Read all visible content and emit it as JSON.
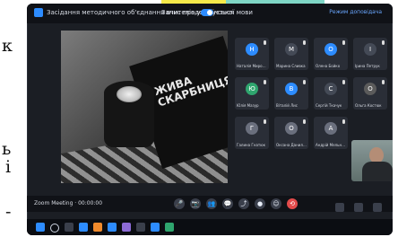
{
  "left_text_fragments": [
    "к",
    "ь",
    "і",
    "-"
  ],
  "zoom": {
    "title": "Засідання методичного об'єднання вчителів української мови",
    "recording_label": "Запис продовжується",
    "top_right_label": "Режим доповідача",
    "shared_book_title": "ЖИВА СКАРБНИЦЯ",
    "meeting_meta": "Zoom Meeting · 00:00:00",
    "participants": [
      {
        "name": "Наталія Миронюк",
        "initial": "Н",
        "color": "#2d8cff"
      },
      {
        "name": "Марина Сливка",
        "initial": "М",
        "color": "#444a56"
      },
      {
        "name": "Олена Бойко",
        "initial": "О",
        "color": "#2d8cff"
      },
      {
        "name": "Ірина Петрук",
        "initial": "І",
        "color": "#444a56"
      },
      {
        "name": "Юлія Мазур",
        "initial": "Ю",
        "color": "#2fa56e"
      },
      {
        "name": "Віталій Лис",
        "initial": "В",
        "color": "#2d8cff"
      },
      {
        "name": "Сергій Ткачук",
        "initial": "С",
        "color": "#444a56"
      },
      {
        "name": "Ольга Костюк",
        "initial": "О",
        "color": "#5b5b5b"
      },
      {
        "name": "Галина Гнатюк",
        "initial": "Г",
        "color": "#6a6f7d"
      },
      {
        "name": "Оксана Данилюк",
        "initial": "О",
        "color": "#6a6f7d"
      },
      {
        "name": "Андрій Мельник",
        "initial": "А",
        "color": "#6a6f7d"
      }
    ],
    "controls": [
      {
        "name": "microphone",
        "icon": "mic-icon",
        "glyph": "🎤"
      },
      {
        "name": "video",
        "icon": "camera-icon",
        "glyph": "📷"
      },
      {
        "name": "participants",
        "icon": "people-icon",
        "glyph": "👥"
      },
      {
        "name": "chat",
        "icon": "chat-icon",
        "glyph": "💬"
      },
      {
        "name": "share",
        "icon": "share-icon",
        "glyph": "⤴"
      },
      {
        "name": "record",
        "icon": "record-icon",
        "glyph": "●"
      },
      {
        "name": "reactions",
        "icon": "smile-icon",
        "glyph": "☺"
      },
      {
        "name": "leave",
        "icon": "leave-icon",
        "glyph": "⟲"
      }
    ]
  },
  "taskbar": {
    "icons": [
      "windows-icon",
      "search-icon",
      "task-view-icon",
      "edge-icon",
      "explorer-icon",
      "zoom-icon",
      "store-icon",
      "mail-icon",
      "word-icon",
      "teams-icon"
    ]
  },
  "colors": {
    "screen_bg": "#1b1e24",
    "accent": "#2d8cff",
    "leave": "#e24b4b",
    "highlight_yellow": "#f5e94a",
    "highlight_teal": "#7fd6c6"
  }
}
